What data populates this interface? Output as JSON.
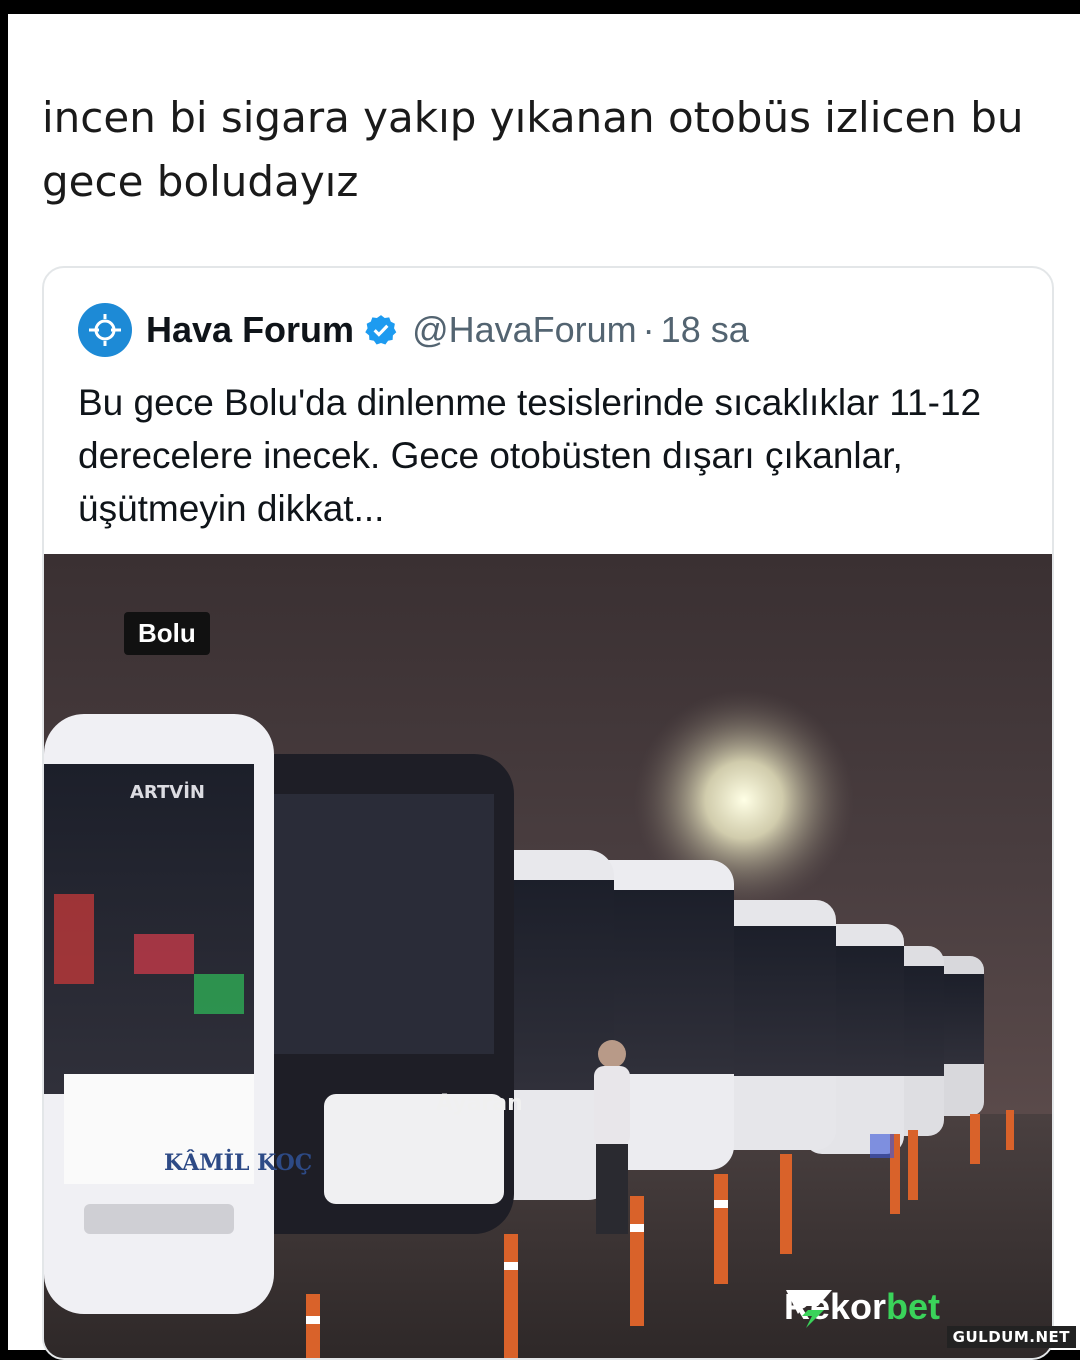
{
  "post": {
    "caption": "incen bi sigara yakıp yıkanan otobüs izlicen bu gece boludayız"
  },
  "quoted": {
    "name": "Hava Forum",
    "handle": "@HavaForum",
    "separator": "·",
    "time": "18 sa",
    "text": "Bu gece Bolu'da dinlenme tesislerinde sıcaklıklar 11-12 derecelere inecek. Gece otobüsten dışarı çıkanlar, üşütmeyin dikkat...",
    "avatar_icon": "hava-forum-logo-icon",
    "verified_icon": "verified-badge-icon",
    "accent_color": "#1d9bf0"
  },
  "photo": {
    "location_tag": "Bolu",
    "bus_texts": [
      "ARTVİN",
      "KÂMİL KOÇ",
      "Ayaran"
    ]
  },
  "branding": {
    "rekor_part1": "Rekor",
    "rekor_part2": "bet",
    "rekor_color": "#3ad35a",
    "watermark": "GULDUM.NET"
  }
}
